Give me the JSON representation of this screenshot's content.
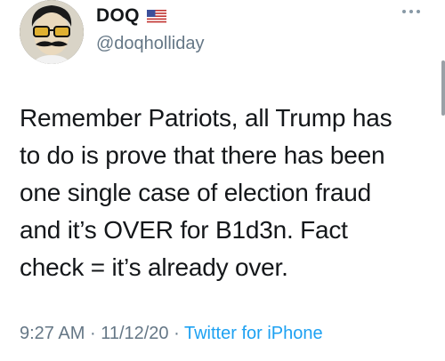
{
  "user": {
    "display_name": "DOQ",
    "handle": "@doqholliday",
    "flag_icon": "us-flag-icon",
    "avatar_icon": "mustache-sunglasses-avatar"
  },
  "tweet": {
    "lines": [
      "Remember Patriots, all Trump has",
      "to do is prove that there has been",
      "one single case of election fraud",
      "and it’s OVER for B1d3n. Fact",
      "check = it’s already over."
    ],
    "time": "9:27 AM",
    "date": "11/12/20",
    "separator": "·",
    "source": "Twitter for iPhone"
  },
  "colors": {
    "text": "#14171a",
    "secondary": "#657786",
    "link": "#1da1f2"
  }
}
